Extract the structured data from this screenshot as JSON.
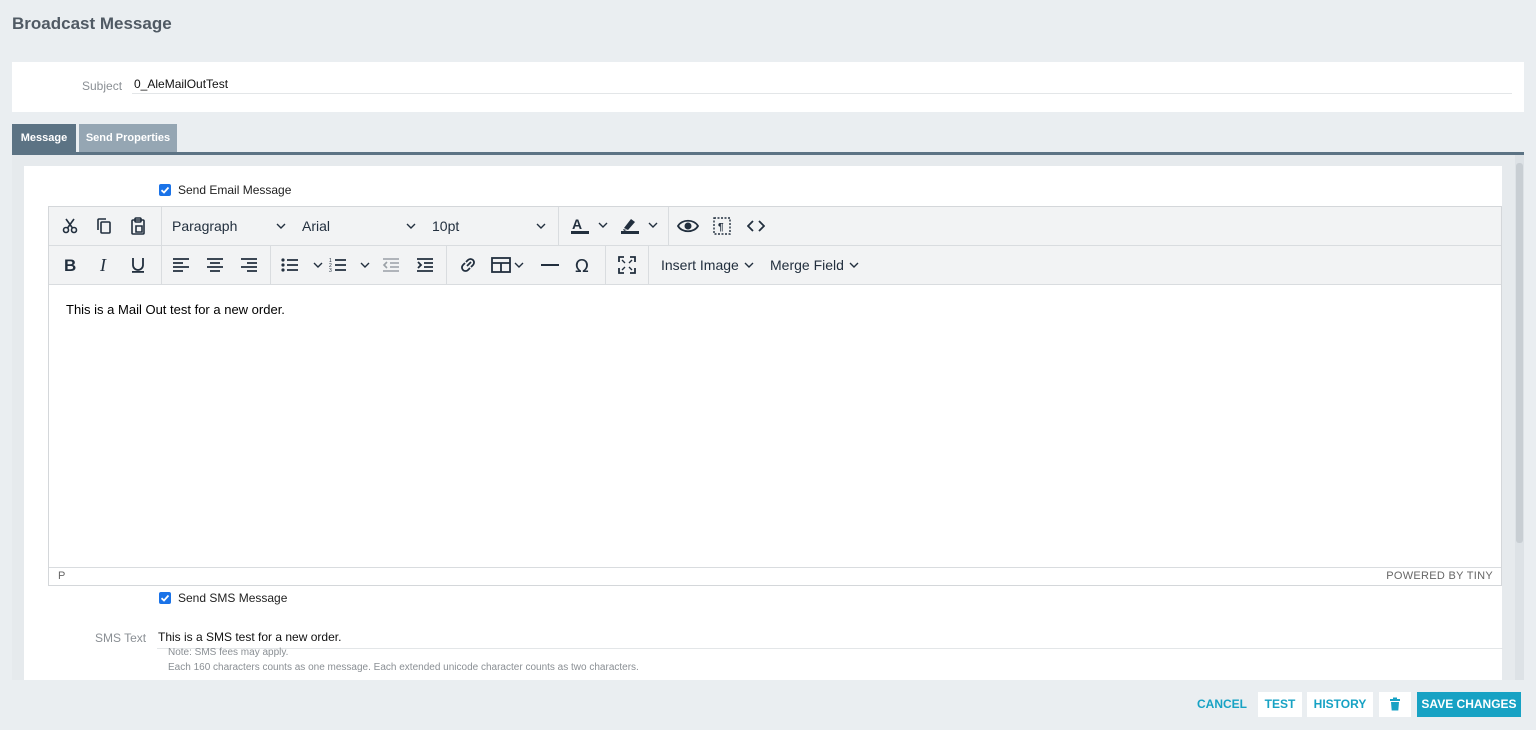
{
  "page": {
    "title": "Broadcast Message"
  },
  "subject": {
    "label": "Subject",
    "value": "0_AleMailOutTest"
  },
  "tabs": [
    {
      "label": "Message",
      "active": true
    },
    {
      "label": "Send Properties",
      "active": false
    }
  ],
  "email": {
    "checkbox_label": "Send Email Message",
    "checked": true,
    "toolbar": {
      "block_format": "Paragraph",
      "font_family": "Arial",
      "font_size": "10pt",
      "insert_image": "Insert Image",
      "merge_field": "Merge Field"
    },
    "content": "This is a Mail Out test for a new order.",
    "status_path": "P",
    "powered_by": "POWERED BY TINY"
  },
  "sms": {
    "checkbox_label": "Send SMS Message",
    "checked": true,
    "label": "SMS Text",
    "value": "This is a SMS test for a new order.",
    "notes": [
      "Note: SMS fees may apply.",
      "Each 160 characters counts as one message. Each extended unicode character counts as two characters."
    ]
  },
  "footer": {
    "cancel": "CANCEL",
    "test": "TEST",
    "history": "HISTORY",
    "save": "SAVE CHANGES"
  },
  "colors": {
    "accent": "#17a2c4",
    "tab_active": "#5c7384",
    "tab_inactive": "#95a6b3",
    "checkbox": "#1a73e8"
  }
}
